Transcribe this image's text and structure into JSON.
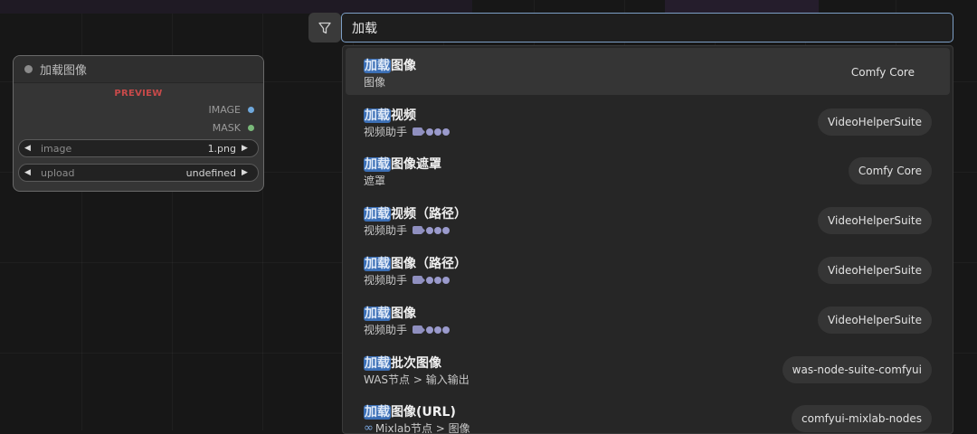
{
  "node": {
    "title": "加载图像",
    "preview_label": "PREVIEW",
    "outputs": [
      {
        "label": "IMAGE",
        "color": "#6fa8dc"
      },
      {
        "label": "MASK",
        "color": "#7ab97a"
      }
    ],
    "widgets": [
      {
        "label": "image",
        "value": "1.png"
      },
      {
        "label": "upload",
        "value": "undefined"
      }
    ]
  },
  "search": {
    "query": "加载"
  },
  "results": [
    {
      "highlight": "加载",
      "title_rest": "图像",
      "subtitle": "图像",
      "badge": "Comfy Core",
      "selected": true,
      "vhs": false
    },
    {
      "highlight": "加载",
      "title_rest": "视频",
      "subtitle": "视频助手",
      "badge": "VideoHelperSuite",
      "selected": false,
      "vhs": true
    },
    {
      "highlight": "加载",
      "title_rest": "图像遮罩",
      "subtitle": "遮罩",
      "badge": "Comfy Core",
      "selected": false,
      "vhs": false
    },
    {
      "highlight": "加载",
      "title_rest": "视频（路径）",
      "subtitle": "视频助手",
      "badge": "VideoHelperSuite",
      "selected": false,
      "vhs": true
    },
    {
      "highlight": "加载",
      "title_rest": "图像（路径）",
      "subtitle": "视频助手",
      "badge": "VideoHelperSuite",
      "selected": false,
      "vhs": true
    },
    {
      "highlight": "加载",
      "title_rest": "图像",
      "subtitle": "视频助手",
      "badge": "VideoHelperSuite",
      "selected": false,
      "vhs": true
    },
    {
      "highlight": "加载",
      "title_rest": "批次图像",
      "subtitle": "WAS节点 > 输入输出",
      "badge": "was-node-suite-comfyui",
      "selected": false,
      "vhs": false
    },
    {
      "highlight": "加载",
      "title_rest": "图像(URL)",
      "subtitle": "Mixlab节点 > 图像",
      "badge": "comfyui-mixlab-nodes",
      "selected": false,
      "vhs": false,
      "infinity": true
    }
  ],
  "colors": {
    "accent": "#7d9fc6",
    "highlight": "#3b6fb6",
    "preview": "#c84a4a"
  }
}
